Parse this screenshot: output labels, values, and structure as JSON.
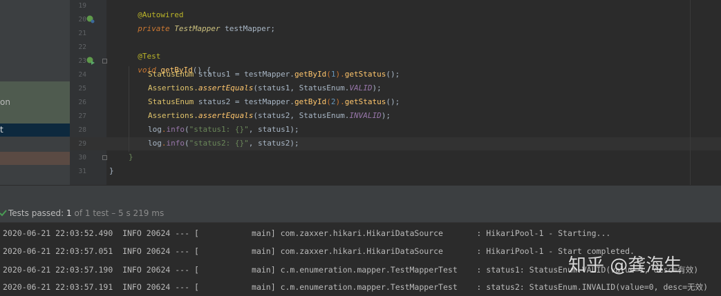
{
  "sidebar": {
    "text_1": "on",
    "text_2": "t"
  },
  "editor": {
    "line_numbers": [
      "19",
      "20",
      "21",
      "22",
      "23",
      "24",
      "25",
      "26",
      "27",
      "28",
      "29",
      "30",
      "31"
    ],
    "code": {
      "l19_anno": "@Autowired",
      "l20_priv": "private",
      "l20_type": "TestMapper",
      "l20_var": "testMapper;",
      "l22_anno": "@Test",
      "l23_void": "void",
      "l23_name": "getById",
      "l23_rest": "() {",
      "l24": [
        "StatusEnum",
        " status1 = testMapper.",
        "getById",
        "(",
        "1",
        ").",
        "getStatus",
        "();"
      ],
      "l25": [
        "Assertions.",
        "assertEquals",
        "(status1, StatusEnum.",
        "VALID",
        ");"
      ],
      "l26": [
        "StatusEnum",
        " status2 = testMapper.",
        "getById",
        "(",
        "2",
        ").",
        "getStatus",
        "();"
      ],
      "l27": [
        "Assertions.",
        "assertEquals",
        "(status2, StatusEnum.",
        "INVALID",
        ");"
      ],
      "l28": [
        "log",
        ".",
        "info",
        "(",
        "\"status1: {}\"",
        ", status1);"
      ],
      "l29": [
        "log",
        ".",
        "info",
        "(",
        "\"status2: {}\"",
        ", status2);"
      ],
      "l30": "}",
      "l31": "}"
    }
  },
  "tests": {
    "label": "Tests passed:",
    "count": "1",
    "detail": "of 1 test – 5 s 219 ms"
  },
  "console": {
    "lines": [
      "2020-06-21 22:03:52.490  INFO 20624 --- [           main] com.zaxxer.hikari.HikariDataSource       : HikariPool-1 - Starting...",
      "2020-06-21 22:03:57.051  INFO 20624 --- [           main] com.zaxxer.hikari.HikariDataSource       : HikariPool-1 - Start completed.",
      "2020-06-21 22:03:57.190  INFO 20624 --- [           main] c.m.enumeration.mapper.TestMapperTest    : status1: StatusEnum.VALID(value=1, desc=有效)",
      "2020-06-21 22:03:57.191  INFO 20624 --- [           main] c.m.enumeration.mapper.TestMapperTest    : status2: StatusEnum.INVALID(value=0, desc=无效)"
    ]
  },
  "watermark": "知乎 @龚海生",
  "colors": {
    "background": "#2b2b2b",
    "panel": "#3c3f41",
    "keyword": "#cc7832",
    "method": "#ffc66d",
    "string": "#6a8759",
    "number": "#6897bb",
    "pass_green": "#499c54"
  }
}
